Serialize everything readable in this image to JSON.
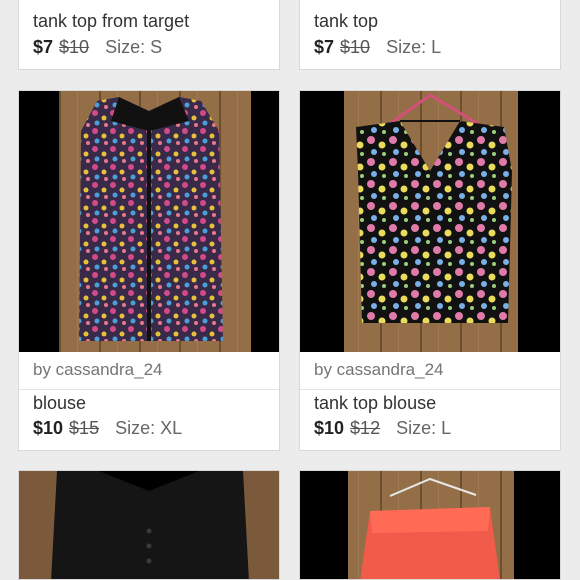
{
  "cards": [
    {
      "title": "tank top from target",
      "price": "$7",
      "original_price": "$10",
      "size_label": "Size: S"
    },
    {
      "title": "tank top",
      "price": "$7",
      "original_price": "$10",
      "size_label": "Size: L"
    },
    {
      "seller": "by cassandra_24",
      "title": "blouse",
      "price": "$10",
      "original_price": "$15",
      "size_label": "Size: XL"
    },
    {
      "seller": "by cassandra_24",
      "title": "tank top blouse",
      "price": "$10",
      "original_price": "$12",
      "size_label": "Size: L"
    },
    {},
    {}
  ],
  "icons": {
    "hanger": "hanger-icon"
  }
}
